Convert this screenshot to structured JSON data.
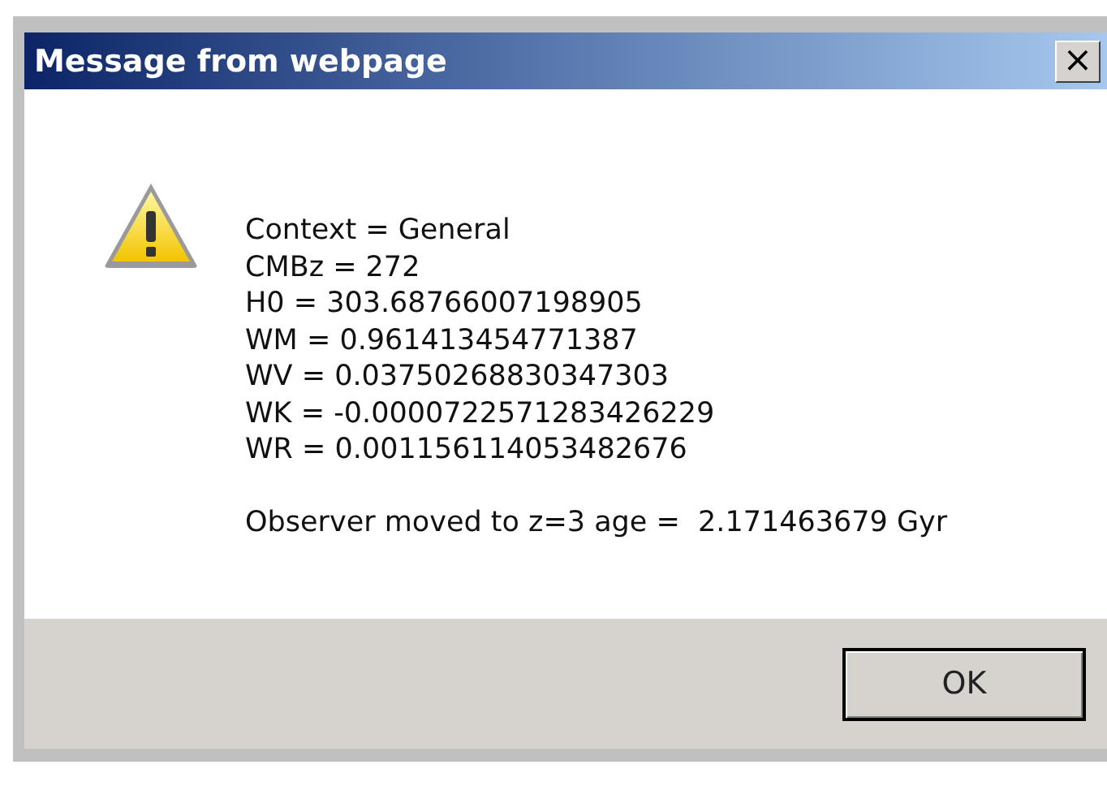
{
  "window": {
    "title": "Message from webpage",
    "close": "×"
  },
  "message": {
    "lines": [
      "Context = General",
      "CMBz = 272",
      "H0 = 303.68766007198905",
      "WM = 0.961413454771387",
      "WV = 0.03750268830347303",
      "WK = -0.0000722571283426229",
      "WR = 0.001156114053482676"
    ],
    "result": "Observer moved to z=3 age =  2.171463679 Gyr"
  },
  "buttons": [
    {
      "label": "OK",
      "selected": true
    }
  ]
}
